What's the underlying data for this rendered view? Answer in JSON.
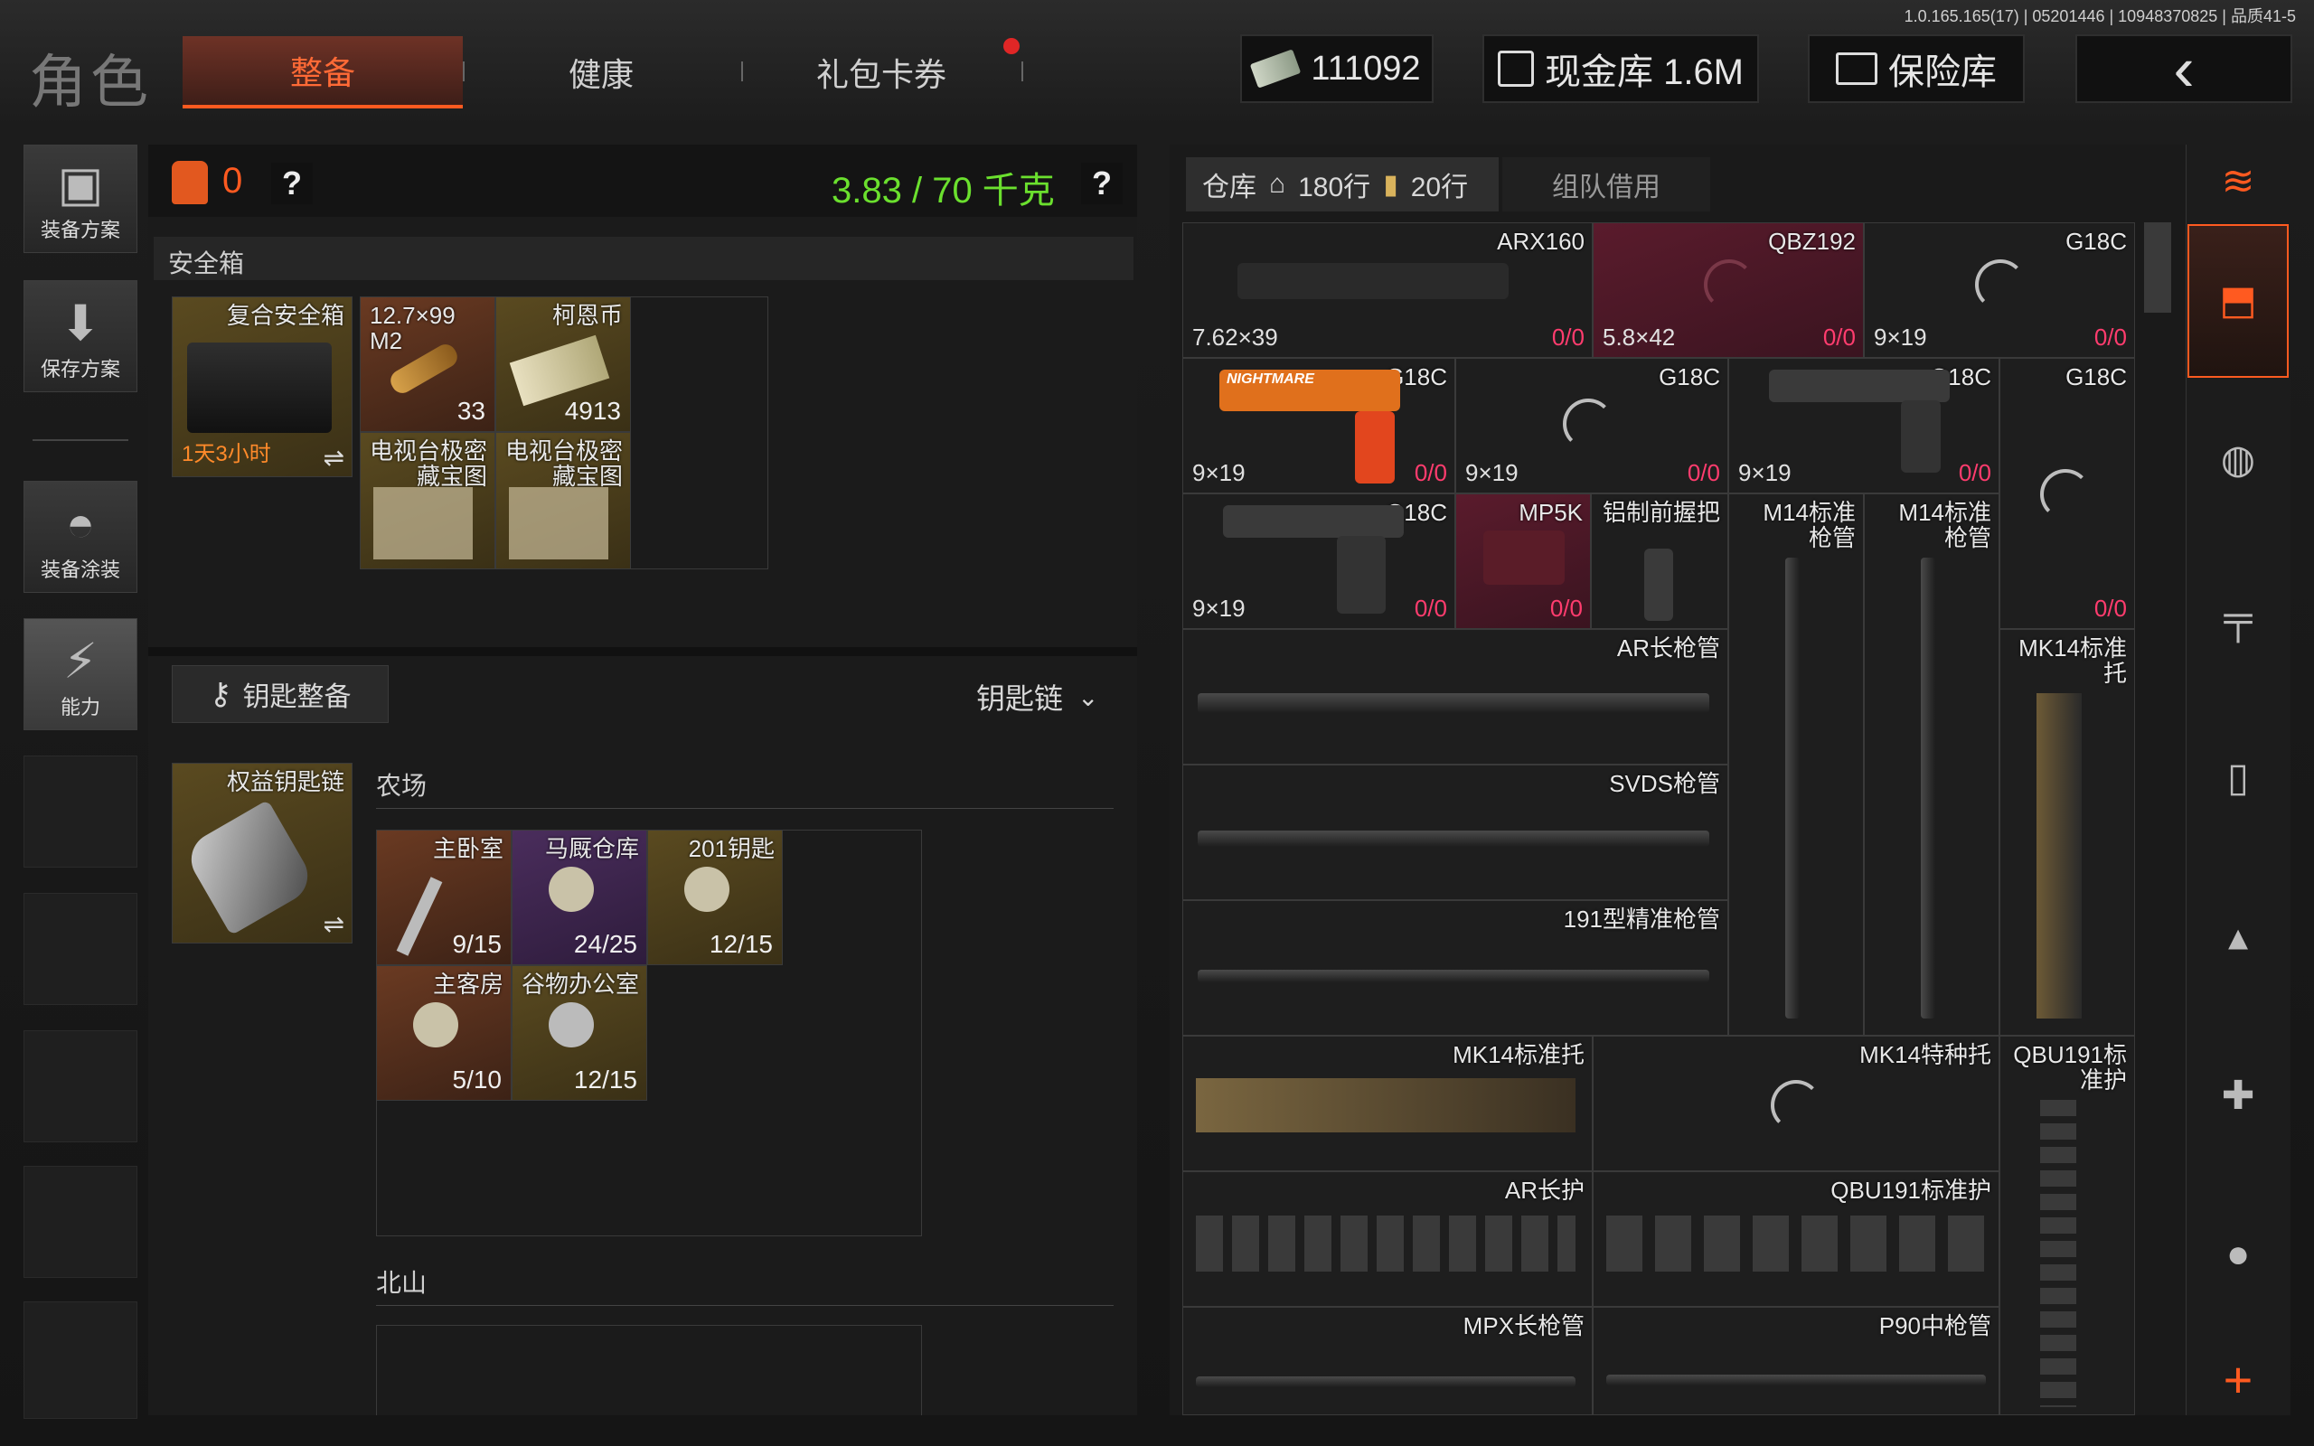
{
  "header": {
    "title": "角色",
    "tabs": [
      {
        "label": "整备",
        "active": true
      },
      {
        "label": "健康"
      },
      {
        "label": "礼包卡券"
      }
    ],
    "currency": "111092",
    "cash_vault": "现金库 1.6M",
    "safe": "保险库",
    "version": "1.0.165.165(17) | 05201446 | 10948370825 | 品质41-5"
  },
  "left_rail": [
    {
      "label": "装备方案",
      "icon": "vest-icon"
    },
    {
      "label": "保存方案",
      "icon": "download-icon"
    },
    {
      "label": "装备涂装",
      "icon": "helmet-icon"
    },
    {
      "label": "能力",
      "icon": "ability-icon"
    }
  ],
  "loadout": {
    "armor_count": "0",
    "help": "?",
    "weight": "3.83 / 70 千克",
    "safe_box_title": "安全箱",
    "safe_box": {
      "name": "复合安全箱",
      "timer": "1天3小时"
    },
    "safe_items": [
      {
        "name": "12.7×99 M2",
        "count": "33"
      },
      {
        "name": "柯恩币",
        "count": "4913"
      },
      {
        "name": "电视台极密藏宝图"
      },
      {
        "name": "电视台极密藏宝图"
      }
    ],
    "key_section": {
      "button": "钥匙整备",
      "dropdown": "钥匙链"
    },
    "keychain": {
      "name": "权益钥匙链"
    },
    "farm_title": "农场",
    "farm_keys": [
      {
        "name": "主卧室",
        "uses": "9/15"
      },
      {
        "name": "马厩仓库",
        "uses": "24/25"
      },
      {
        "name": "201钥匙",
        "uses": "12/15"
      },
      {
        "name": "主客房",
        "uses": "5/10"
      },
      {
        "name": "谷物办公室",
        "uses": "12/15"
      }
    ],
    "north_title": "北山"
  },
  "warehouse": {
    "tab": "仓库",
    "rows": "180行",
    "ammo_rows": "20行",
    "team_tab": "组队借用",
    "items": [
      {
        "name": "ARX160",
        "caliber": "7.62×39",
        "dur": "0/0"
      },
      {
        "name": "QBZ192",
        "caliber": "5.8×42",
        "dur": "0/0"
      },
      {
        "name": "G18C",
        "caliber": "9×19",
        "dur": "0/0"
      },
      {
        "name": "G18C",
        "caliber": "9×19",
        "dur": "0/0",
        "skin": "NIGHTMARE"
      },
      {
        "name": "G18C",
        "caliber": "9×19",
        "dur": "0/0"
      },
      {
        "name": "G18C",
        "caliber": "9×19",
        "dur": "0/0"
      },
      {
        "name": "G18C",
        "dur": "0/0"
      },
      {
        "name": "G18C",
        "caliber": "9×19",
        "dur": "0/0"
      },
      {
        "name": "MP5K",
        "dur": "0/0"
      },
      {
        "name": "铝制前握把"
      },
      {
        "name": "M14标准枪管"
      },
      {
        "name": "M14标准枪管"
      },
      {
        "name": "0/0"
      },
      {
        "name": "AR长枪管"
      },
      {
        "name": "MK14标准托"
      },
      {
        "name": "SVDS枪管"
      },
      {
        "name": "191型精准枪管"
      },
      {
        "name": "MK14标准托"
      },
      {
        "name": "MK14特种托"
      },
      {
        "name": "QBU191标准护"
      },
      {
        "name": "AR长护"
      },
      {
        "name": "QBU191标准护"
      },
      {
        "name": "MPX长枪管"
      },
      {
        "name": "P90中枪管"
      }
    ]
  },
  "colors": {
    "accent": "#ff5a20",
    "weight_green": "#6be02e",
    "durability": "#ff3c6e",
    "gold_cell": "#5a4a20",
    "purple_cell": "#4a2d5c",
    "red_cell": "#5a1b2c"
  }
}
